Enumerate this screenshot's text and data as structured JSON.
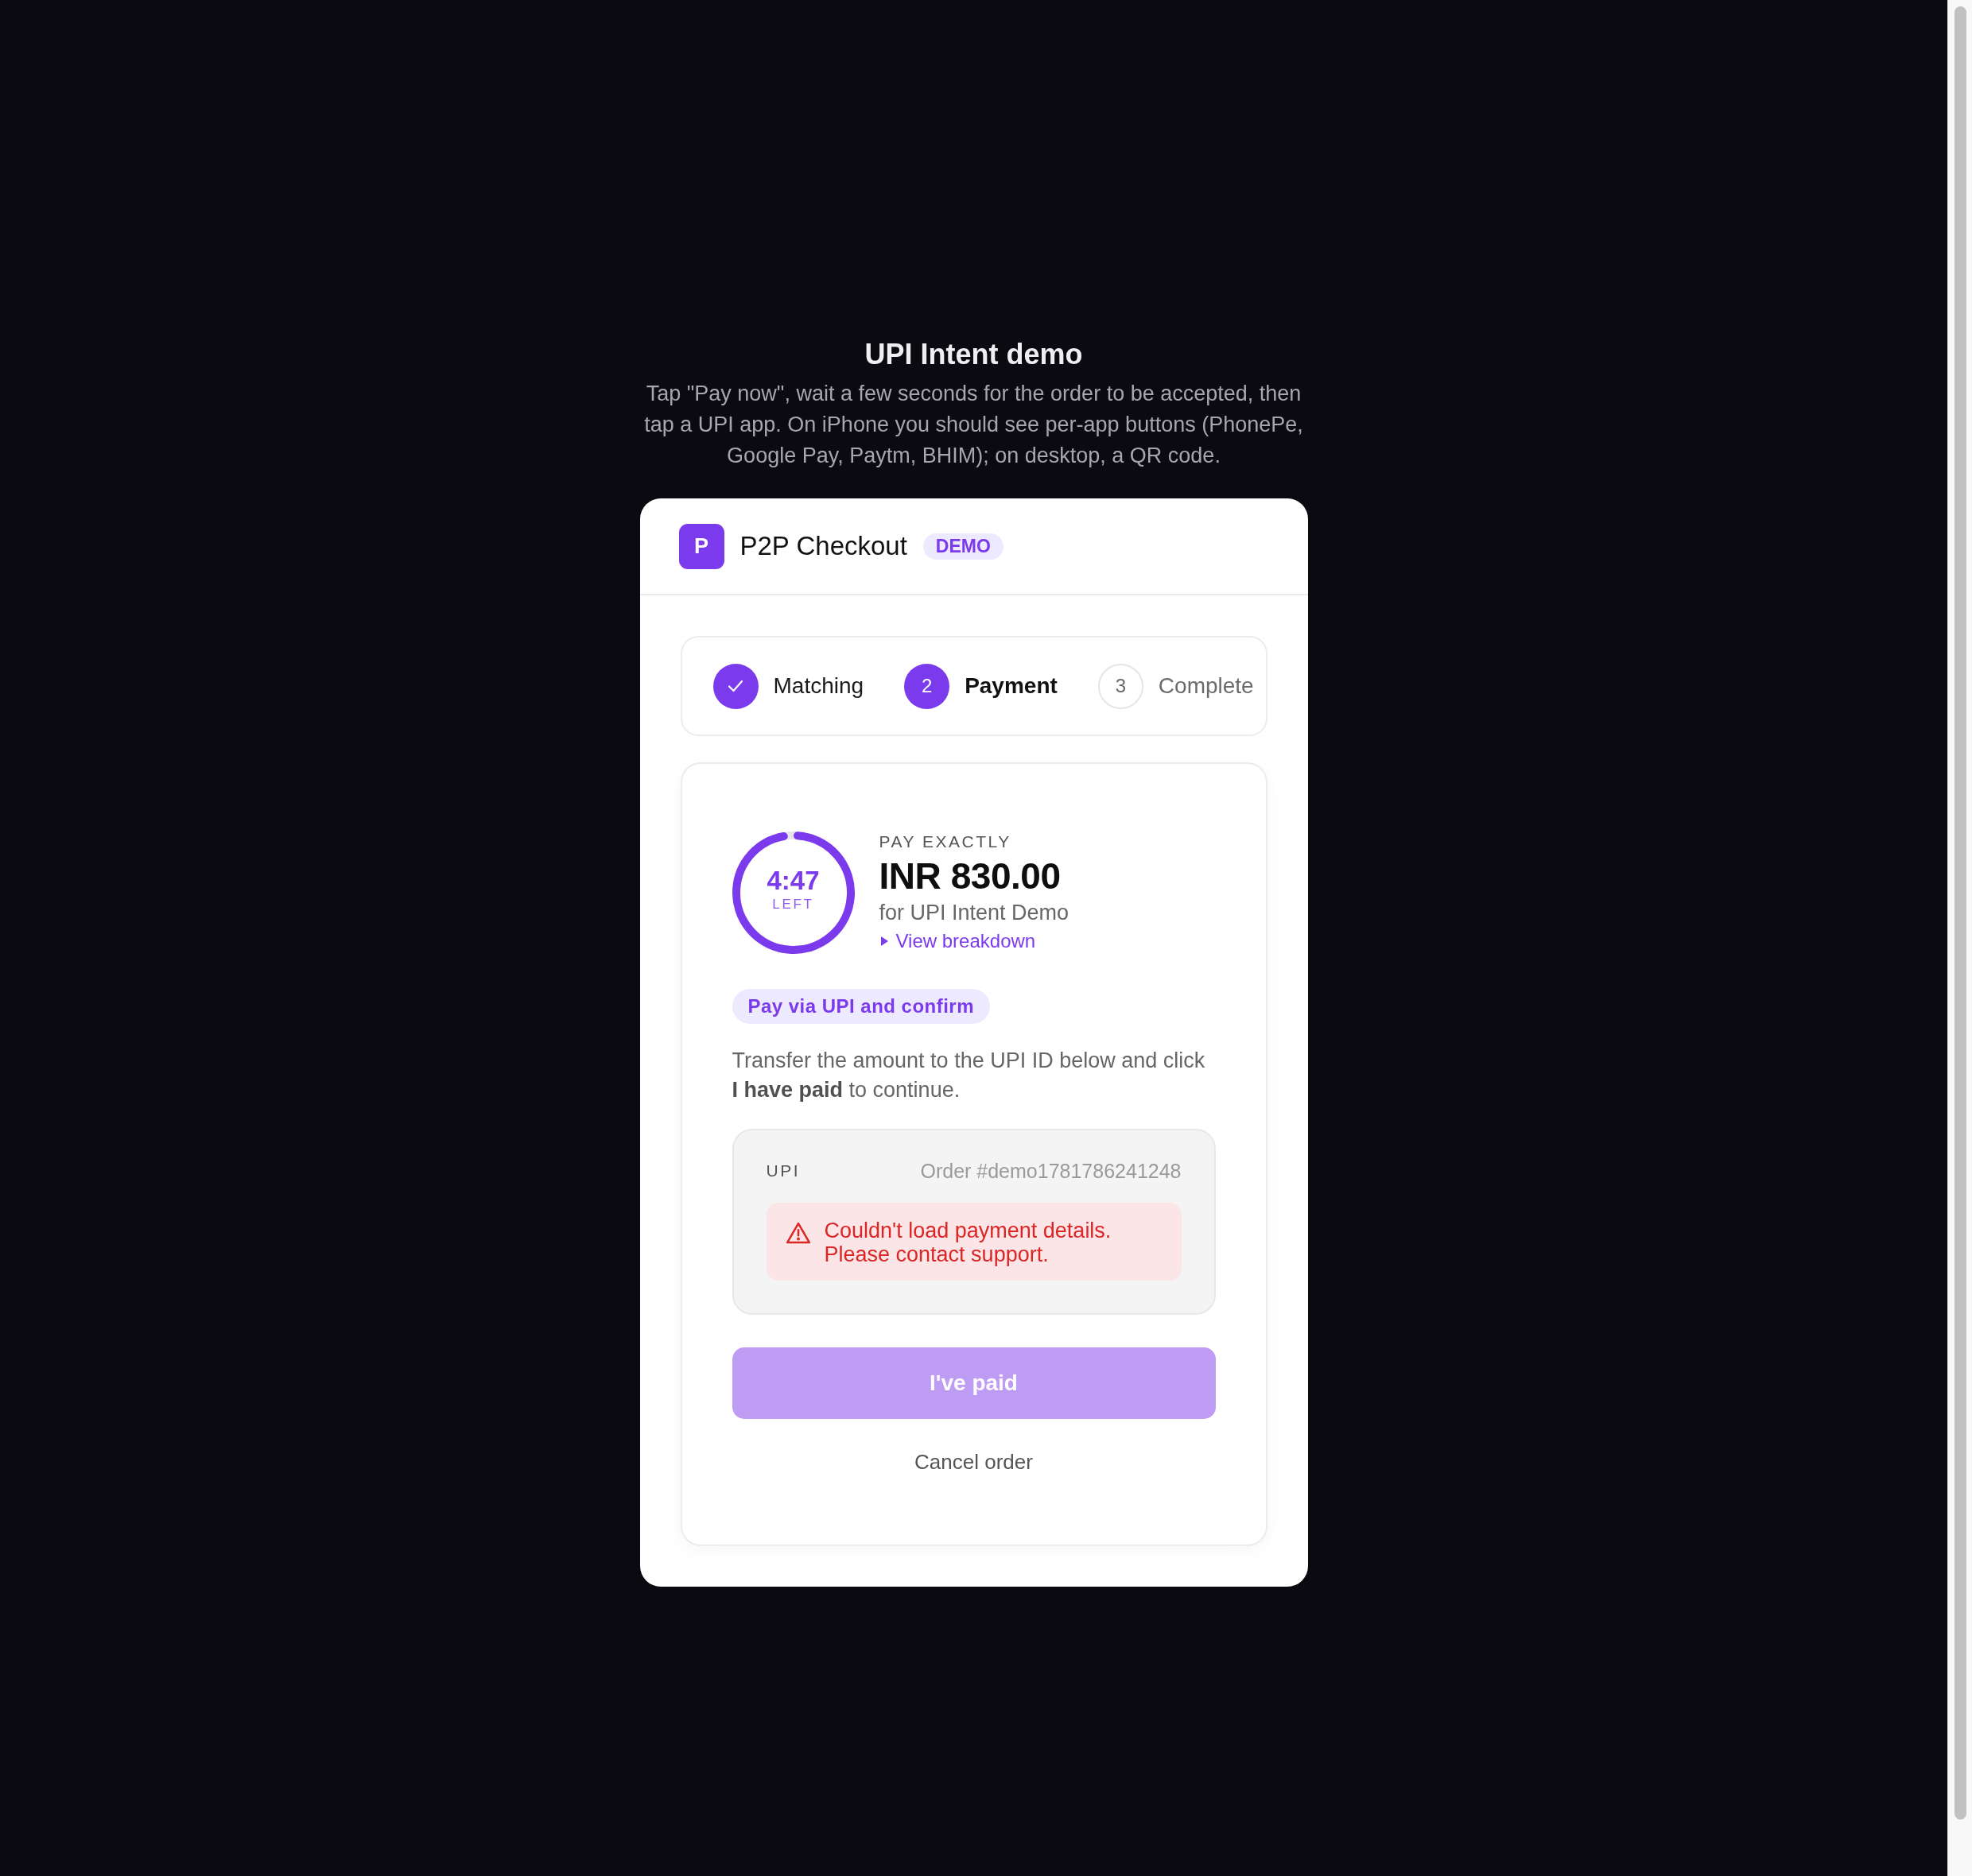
{
  "page": {
    "title": "UPI Intent demo",
    "description": "Tap \"Pay now\", wait a few seconds for the order to be accepted, then tap a UPI app. On iPhone you should see per-app buttons (PhonePe, Google Pay, Paytm, BHIM); on desktop, a QR code."
  },
  "checkout": {
    "logo": "P",
    "title": "P2P Checkout",
    "badge": "DEMO"
  },
  "steps": [
    {
      "label": "Matching",
      "completed": true,
      "selected": false
    },
    {
      "number": "2",
      "label": "Payment",
      "completed": false,
      "selected": true
    },
    {
      "number": "3",
      "label": "Complete",
      "completed": false,
      "selected": false
    }
  ],
  "timer": {
    "time": "4:47",
    "caption": "LEFT",
    "level": 0.96
  },
  "amount": {
    "label": "PAY EXACTLY",
    "value": "INR 830.00",
    "subtitle": "for UPI Intent Demo",
    "breakdown": {
      "label": "View breakdown",
      "expanded": false
    }
  },
  "instruction": {
    "pill": "Pay via UPI and confirm",
    "text": "Transfer the amount to the UPI ID below and click **I have paid** to continue."
  },
  "upi": {
    "label": "UPI",
    "order": "Order #demo1781786241248",
    "error": "Couldn't load payment details. Please contact support."
  },
  "actions": {
    "primary": {
      "label": "I've paid",
      "disabled": true
    },
    "cancel": "Cancel order"
  }
}
